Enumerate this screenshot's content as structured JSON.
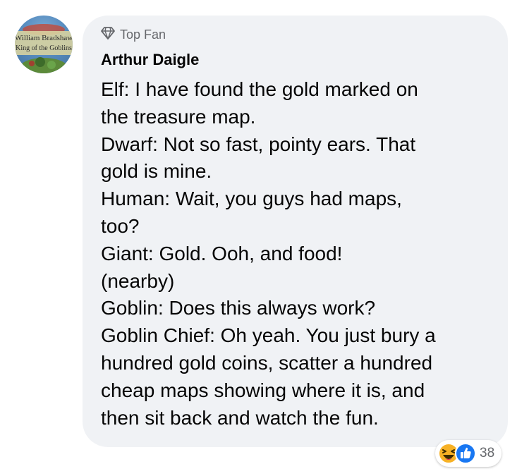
{
  "avatar": {
    "line1": "William Bradshaw",
    "line2": "King of the Goblins"
  },
  "comment": {
    "badge": "Top Fan",
    "author": "Arthur Daigle",
    "lines": [
      "Elf: I have found the gold marked on",
      "the treasure map.",
      "Dwarf: Not so fast, pointy ears.  That",
      "gold is mine.",
      "Human: Wait, you guys had maps,",
      "too?",
      "Giant: Gold.  Ooh, and food!",
      "(nearby)",
      "Goblin: Does this always work?",
      "Goblin Chief: Oh yeah.  You just bury a",
      "hundred gold coins, scatter a hundred",
      "cheap maps showing where it is, and",
      "then sit back and watch the fun."
    ]
  },
  "reactions": {
    "icons": [
      "haha-icon",
      "like-icon"
    ],
    "count": "38",
    "like_color": "#1877f2",
    "haha_color": "#f7b125"
  }
}
